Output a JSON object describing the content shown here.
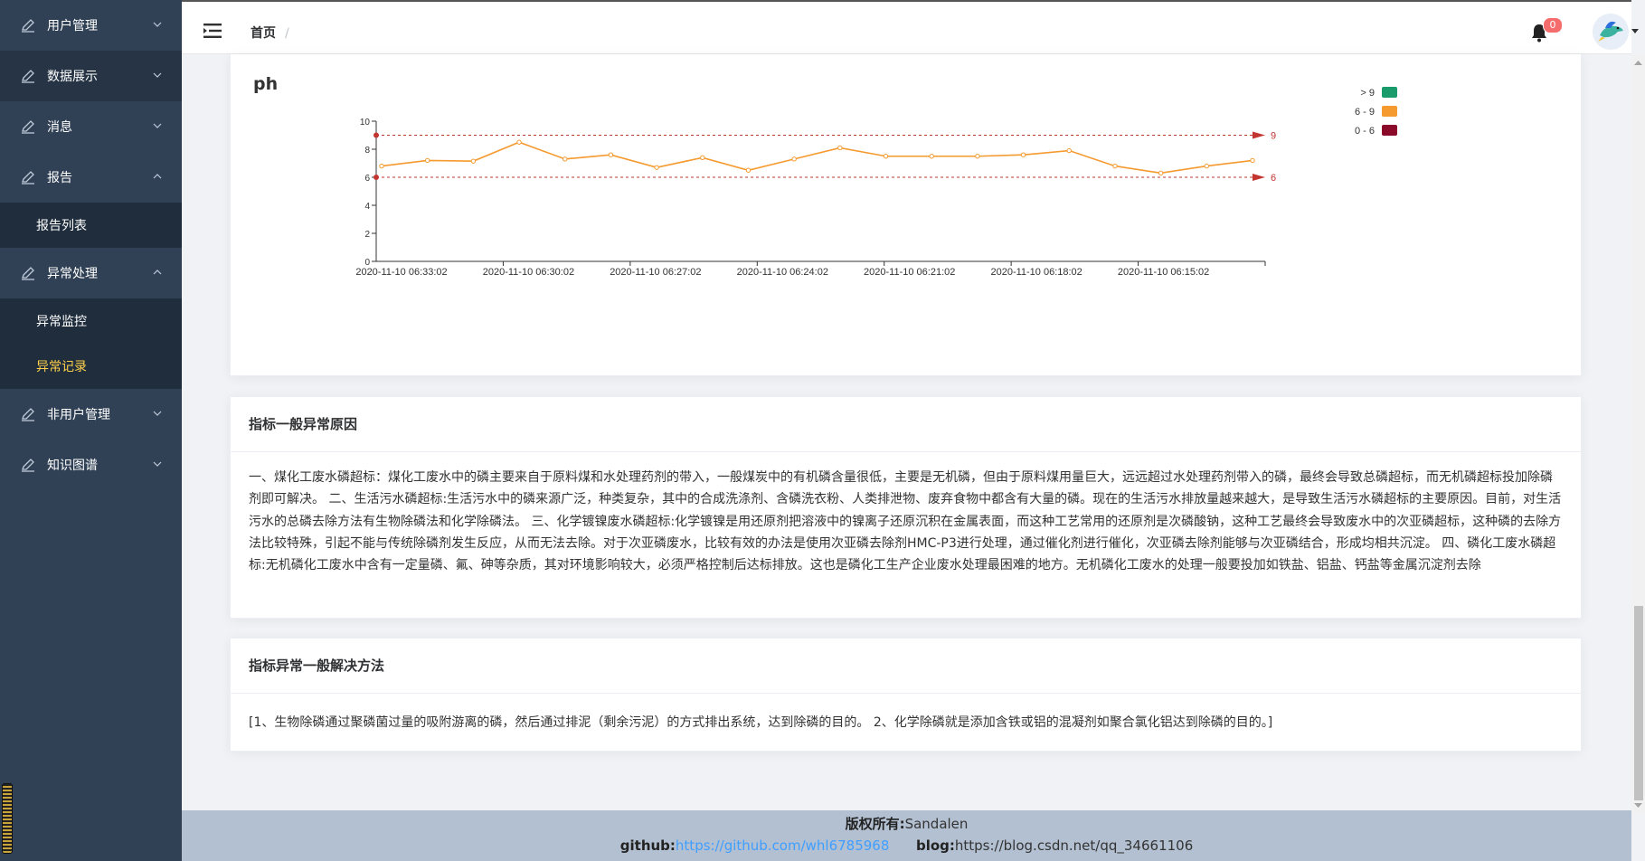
{
  "sidebar": {
    "items": [
      {
        "label": "用户管理",
        "arrow": "down"
      },
      {
        "label": "数据展示",
        "arrow": "down"
      },
      {
        "label": "消息",
        "arrow": "down"
      },
      {
        "label": "报告",
        "arrow": "up"
      },
      {
        "label": "报告列表"
      },
      {
        "label": "异常处理",
        "arrow": "up"
      },
      {
        "label": "异常监控"
      },
      {
        "label": "异常记录"
      },
      {
        "label": "非用户管理",
        "arrow": "down"
      },
      {
        "label": "知识图谱",
        "arrow": "down"
      }
    ]
  },
  "header": {
    "breadcrumb_home": "首页",
    "breadcrumb_sep": "/",
    "notification_count": "0"
  },
  "chart_card": {
    "title": "ph",
    "legend": [
      {
        "label": "> 9",
        "color": "#1a9b6b"
      },
      {
        "label": "6 - 9",
        "color": "#f59a2f"
      },
      {
        "label": "0 - 6",
        "color": "#8b0a2a"
      }
    ],
    "threshold_labels": [
      "9",
      "6"
    ]
  },
  "chart_data": {
    "type": "line",
    "title": "ph",
    "x_tick_labels": [
      "2020-11-10 06:33:02",
      "2020-11-10 06:30:02",
      "2020-11-10 06:27:02",
      "2020-11-10 06:24:02",
      "2020-11-10 06:21:02",
      "2020-11-10 06:18:02",
      "2020-11-10 06:15:02"
    ],
    "values": [
      6.8,
      7.2,
      7.15,
      8.5,
      7.3,
      7.6,
      6.7,
      7.4,
      6.5,
      7.3,
      8.1,
      7.5,
      7.5,
      7.5,
      7.6,
      7.9,
      6.8,
      6.3,
      6.8,
      7.2
    ],
    "yticks": [
      0,
      2,
      4,
      6,
      8,
      10
    ],
    "ylim": [
      0,
      10
    ],
    "thresholds": [
      9,
      6
    ],
    "line_color": "#f59a2f"
  },
  "causes_card": {
    "title": "指标一般异常原因",
    "text": "一、煤化工废水磷超标：煤化工废水中的磷主要来自于原料煤和水处理药剂的带入，一般煤炭中的有机磷含量很低，主要是无机磷，但由于原料煤用量巨大，远远超过水处理药剂带入的磷，最终会导致总磷超标，而无机磷超标投加除磷剂即可解决。 二、生活污水磷超标:生活污水中的磷来源广泛，种类复杂，其中的合成洗涤剂、含磷洗衣粉、人类排泄物、废弃食物中都含有大量的磷。现在的生活污水排放量越来越大，是导致生活污水磷超标的主要原因。目前，对生活污水的总磷去除方法有生物除磷法和化学除磷法。 三、化学镀镍废水磷超标:化学镀镍是用还原剂把溶液中的镍离子还原沉积在金属表面，而这种工艺常用的还原剂是次磷酸钠，这种工艺最终会导致废水中的次亚磷超标，这种磷的去除方法比较特殊，引起不能与传统除磷剂发生反应，从而无法去除。对于次亚磷废水，比较有效的办法是使用次亚磷去除剂HMC-P3进行处理，通过催化剂进行催化，次亚磷去除剂能够与次亚磷结合，形成均相共沉淀。 四、磷化工废水磷超标:无机磷化工废水中含有一定量磷、氟、砷等杂质，其对环境影响较大，必须严格控制后达标排放。这也是磷化工生产企业废水处理最困难的地方。无机磷化工废水的处理一般要投加如铁盐、铝盐、钙盐等金属沉淀剂去除"
  },
  "solutions_card": {
    "title": "指标异常一般解决方法",
    "text": "[1、生物除磷通过聚磷菌过量的吸附游离的磷，然后通过排泥（剩余污泥）的方式排出系统，达到除磷的目的。 2、化学除磷就是添加含铁或铝的混凝剂如聚合氯化铝达到除磷的目的。]"
  },
  "footer": {
    "copyright_label": "版权所有:",
    "copyright_value": "Sandalen",
    "github_label": "github:",
    "github_url": "https://github.com/whl6785968",
    "blog_label": "blog:",
    "blog_url": "https://blog.csdn.net/qq_34661106"
  }
}
